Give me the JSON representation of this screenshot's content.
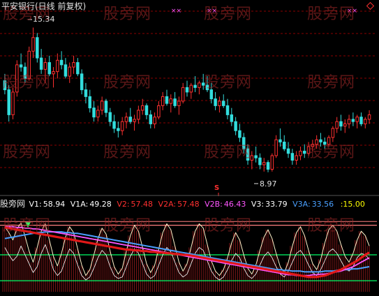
{
  "title": "平安银行(日线 前复权)",
  "watermark": "股旁网",
  "price_high_label": "15.34",
  "price_low_label": "8.97",
  "signal_label": "S",
  "indicator": {
    "name": "股旁网",
    "items": [
      {
        "label": "V1:",
        "value": "58.94",
        "color": "#ffffff"
      },
      {
        "label": "V1A:",
        "value": "49.28",
        "color": "#ffffff"
      },
      {
        "label": "V2:",
        "value": "57.48",
        "color": "#ff3030"
      },
      {
        "label": "V2A:",
        "value": "57.48",
        "color": "#ff3030"
      },
      {
        "label": "V2B:",
        "value": "46.43",
        "color": "#ff55ff"
      },
      {
        "label": "V3:",
        "value": "33.79",
        "color": "#ffffff"
      },
      {
        "label": "V3A:",
        "value": "33.56",
        "color": "#4aa0ff"
      },
      {
        "label": "",
        "value": ":15.00",
        "color": "#ffff00"
      }
    ]
  },
  "colors": {
    "up": "#ff3030",
    "down": "#33dddd",
    "grid": "#8b0000",
    "v1": "#fff0c8",
    "v1a": "#ffffff",
    "v2": "#e01818",
    "v2b": "#ff55ff",
    "v3a": "#4aa0ff",
    "level": "#00ff66",
    "volume": "#aa2020"
  },
  "chart_data": [
    {
      "type": "candlestick",
      "ylim": [
        8.5,
        16.0
      ],
      "candles": [
        [
          13.0,
          13.3,
          12.4,
          12.6
        ],
        [
          12.6,
          12.8,
          11.2,
          11.5
        ],
        [
          11.5,
          12.7,
          11.3,
          12.5
        ],
        [
          12.5,
          13.9,
          12.3,
          13.7
        ],
        [
          13.7,
          14.2,
          13.4,
          13.6
        ],
        [
          13.6,
          13.8,
          12.9,
          13.1
        ],
        [
          13.1,
          14.5,
          13.0,
          14.3
        ],
        [
          14.3,
          15.34,
          14.0,
          14.9
        ],
        [
          14.9,
          15.1,
          13.8,
          14.0
        ],
        [
          14.0,
          14.4,
          13.3,
          13.5
        ],
        [
          13.5,
          14.0,
          12.9,
          13.8
        ],
        [
          13.8,
          14.1,
          13.2,
          13.3
        ],
        [
          13.3,
          13.6,
          12.7,
          13.4
        ],
        [
          13.4,
          14.2,
          13.1,
          13.9
        ],
        [
          13.9,
          14.3,
          13.5,
          13.7
        ],
        [
          13.7,
          14.0,
          13.1,
          13.2
        ],
        [
          13.2,
          13.8,
          12.9,
          13.6
        ],
        [
          13.6,
          14.1,
          13.3,
          13.8
        ],
        [
          13.8,
          14.0,
          13.2,
          13.3
        ],
        [
          13.3,
          13.5,
          12.4,
          12.6
        ],
        [
          12.6,
          12.9,
          12.0,
          12.3
        ],
        [
          12.3,
          12.6,
          11.6,
          11.8
        ],
        [
          11.8,
          12.1,
          11.2,
          11.4
        ],
        [
          11.4,
          11.9,
          11.2,
          11.7
        ],
        [
          11.7,
          12.3,
          11.5,
          12.1
        ],
        [
          12.1,
          12.2,
          11.4,
          11.6
        ],
        [
          11.6,
          11.8,
          11.0,
          11.2
        ],
        [
          11.2,
          11.5,
          10.7,
          10.9
        ],
        [
          10.9,
          11.2,
          10.5,
          10.8
        ],
        [
          10.8,
          11.4,
          10.6,
          11.2
        ],
        [
          11.2,
          11.6,
          10.9,
          11.4
        ],
        [
          11.4,
          11.8,
          11.1,
          11.2
        ],
        [
          11.2,
          11.5,
          10.8,
          11.3
        ],
        [
          11.3,
          11.9,
          11.1,
          11.7
        ],
        [
          11.7,
          12.2,
          11.5,
          11.9
        ],
        [
          11.9,
          12.0,
          11.3,
          11.5
        ],
        [
          11.5,
          11.7,
          10.9,
          11.1
        ],
        [
          11.1,
          11.6,
          10.9,
          11.4
        ],
        [
          11.4,
          12.1,
          11.3,
          11.9
        ],
        [
          11.9,
          12.5,
          11.7,
          12.3
        ],
        [
          12.3,
          12.6,
          11.9,
          12.0
        ],
        [
          12.0,
          12.4,
          11.6,
          12.2
        ],
        [
          12.2,
          12.5,
          11.8,
          11.9
        ],
        [
          11.9,
          12.3,
          11.5,
          12.1
        ],
        [
          12.1,
          12.9,
          12.0,
          12.7
        ],
        [
          12.7,
          13.0,
          12.3,
          12.5
        ],
        [
          12.5,
          12.9,
          12.2,
          12.8
        ],
        [
          12.8,
          13.2,
          12.5,
          12.7
        ],
        [
          12.7,
          13.0,
          12.4,
          12.9
        ],
        [
          12.9,
          13.3,
          12.6,
          12.8
        ],
        [
          12.8,
          13.2,
          12.5,
          12.6
        ],
        [
          12.6,
          12.9,
          12.0,
          12.2
        ],
        [
          12.2,
          12.5,
          11.7,
          11.9
        ],
        [
          11.9,
          12.3,
          11.6,
          12.1
        ],
        [
          12.1,
          12.4,
          11.8,
          11.9
        ],
        [
          11.9,
          12.2,
          11.3,
          11.5
        ],
        [
          11.5,
          11.8,
          11.0,
          11.2
        ],
        [
          11.2,
          11.4,
          10.6,
          10.8
        ],
        [
          10.8,
          11.1,
          10.3,
          10.5
        ],
        [
          10.5,
          10.7,
          9.8,
          10.0
        ],
        [
          10.0,
          10.2,
          9.3,
          9.5
        ],
        [
          9.5,
          9.9,
          9.1,
          9.7
        ],
        [
          9.7,
          10.1,
          9.4,
          9.6
        ],
        [
          9.6,
          9.8,
          9.1,
          9.3
        ],
        [
          9.3,
          9.6,
          9.0,
          9.4
        ],
        [
          9.4,
          9.5,
          8.97,
          9.1
        ],
        [
          9.1,
          9.8,
          9.0,
          9.7
        ],
        [
          9.7,
          10.6,
          9.6,
          10.4
        ],
        [
          10.4,
          10.9,
          10.1,
          10.3
        ],
        [
          10.3,
          10.6,
          9.9,
          10.0
        ],
        [
          10.0,
          10.3,
          9.6,
          9.8
        ],
        [
          9.8,
          10.0,
          9.3,
          9.5
        ],
        [
          9.5,
          9.9,
          9.3,
          9.7
        ],
        [
          9.7,
          10.1,
          9.5,
          9.9
        ],
        [
          9.9,
          10.2,
          9.6,
          9.8
        ],
        [
          9.8,
          10.3,
          9.7,
          10.1
        ],
        [
          10.1,
          10.4,
          9.9,
          10.2
        ],
        [
          10.2,
          10.6,
          10.0,
          10.4
        ],
        [
          10.4,
          10.7,
          10.1,
          10.3
        ],
        [
          10.3,
          10.5,
          10.0,
          10.2
        ],
        [
          10.2,
          10.6,
          10.1,
          10.5
        ],
        [
          10.5,
          11.0,
          10.3,
          10.9
        ],
        [
          10.9,
          11.4,
          10.7,
          11.2
        ],
        [
          11.2,
          11.5,
          10.8,
          11.0
        ],
        [
          11.0,
          11.3,
          10.7,
          11.1
        ],
        [
          11.1,
          11.5,
          10.9,
          11.3
        ],
        [
          11.3,
          11.6,
          11.0,
          11.2
        ],
        [
          11.2,
          11.5,
          10.9,
          11.4
        ],
        [
          11.4,
          11.6,
          11.0,
          11.1
        ],
        [
          11.1,
          11.4,
          10.9,
          11.3
        ],
        [
          11.3,
          11.7,
          11.1,
          11.5
        ]
      ]
    },
    {
      "type": "line",
      "ylim": [
        0,
        100
      ],
      "levels": [
        15,
        50,
        90
      ],
      "series": [
        {
          "name": "V1",
          "values": [
            88,
            80,
            70,
            85,
            93,
            75,
            55,
            40,
            60,
            82,
            92,
            70,
            48,
            35,
            52,
            74,
            88,
            80,
            58,
            36,
            22,
            30,
            50,
            72,
            86,
            78,
            55,
            34,
            24,
            32,
            55,
            76,
            90,
            82,
            60,
            38,
            26,
            36,
            58,
            80,
            92,
            84,
            62,
            40,
            28,
            38,
            60,
            82,
            92,
            86,
            64,
            42,
            28,
            22,
            30,
            46,
            66,
            80,
            70,
            50,
            32,
            24,
            36,
            56,
            74,
            84,
            72,
            52,
            34,
            26,
            40,
            62,
            80,
            88,
            76,
            56,
            38,
            30,
            44,
            66,
            84,
            90,
            82,
            64,
            48,
            40,
            52,
            70,
            82,
            76,
            62
          ]
        },
        {
          "name": "V1A",
          "values": [
            60,
            50,
            42,
            48,
            62,
            50,
            38,
            26,
            34,
            52,
            64,
            48,
            30,
            22,
            28,
            44,
            58,
            52,
            36,
            22,
            16,
            20,
            32,
            46,
            56,
            50,
            34,
            22,
            18,
            20,
            34,
            48,
            58,
            52,
            38,
            24,
            18,
            22,
            36,
            50,
            60,
            54,
            40,
            26,
            20,
            24,
            38,
            52,
            60,
            56,
            42,
            28,
            20,
            16,
            20,
            30,
            42,
            52,
            46,
            32,
            22,
            18,
            24,
            36,
            48,
            54,
            46,
            34,
            24,
            20,
            28,
            40,
            52,
            56,
            48,
            36,
            26,
            22,
            30,
            42,
            54,
            58,
            52,
            42,
            32,
            28,
            34,
            46,
            52,
            50,
            44
          ]
        },
        {
          "name": "V2",
          "values": [
            87,
            86,
            85,
            84,
            83,
            82,
            81,
            80,
            79,
            78,
            77,
            76,
            75,
            74,
            73,
            72,
            71,
            70,
            69,
            68,
            67,
            66,
            65,
            64,
            63,
            62,
            61,
            60,
            59,
            58,
            57,
            57,
            56,
            56,
            55,
            55,
            54,
            54,
            53,
            53,
            52,
            52,
            51,
            51,
            50,
            50,
            49,
            48,
            47,
            46,
            45,
            44,
            43,
            42,
            41,
            40,
            39,
            38,
            37,
            36,
            35,
            34,
            33,
            32,
            31,
            30,
            29,
            28,
            27,
            26,
            25,
            24,
            23,
            22,
            21,
            20,
            20,
            20,
            21,
            22,
            24,
            26,
            28,
            30,
            33,
            36,
            39,
            42,
            46,
            50,
            53
          ]
        },
        {
          "name": "V2B",
          "values": [
            88,
            88,
            88,
            87,
            87,
            86,
            86,
            85,
            85,
            84,
            83,
            82,
            81,
            80,
            79,
            78,
            77,
            76,
            75,
            74,
            73,
            72,
            71,
            70,
            69,
            68,
            67,
            66,
            65,
            64,
            63,
            62,
            61,
            60,
            59,
            58,
            57,
            56,
            55,
            54,
            53,
            52,
            51,
            50,
            49,
            48,
            47,
            46,
            45,
            44,
            43,
            42,
            41,
            40,
            39,
            38,
            37,
            36,
            35,
            34,
            33,
            32,
            31,
            30,
            29,
            28,
            27,
            26,
            25,
            24,
            23,
            23,
            22,
            22,
            22,
            22,
            23,
            23,
            24,
            24,
            25,
            26,
            27,
            28,
            30,
            32,
            34,
            37,
            40,
            43,
            46
          ]
        },
        {
          "name": "V3A",
          "values": [
            72,
            73,
            74,
            75,
            76,
            77,
            78,
            79,
            80,
            80,
            81,
            81,
            81,
            81,
            81,
            80,
            80,
            79,
            79,
            78,
            77,
            76,
            75,
            74,
            73,
            72,
            71,
            70,
            69,
            68,
            67,
            66,
            65,
            64,
            63,
            62,
            61,
            60,
            59,
            58,
            57,
            56,
            55,
            54,
            53,
            52,
            51,
            50,
            49,
            48,
            47,
            46,
            45,
            44,
            43,
            42,
            41,
            40,
            39,
            38,
            37,
            36,
            35,
            34,
            33,
            32,
            31,
            30,
            30,
            29,
            29,
            28,
            28,
            28,
            27,
            27,
            27,
            27,
            27,
            28,
            28,
            28,
            29,
            29,
            30,
            30,
            31,
            31,
            32,
            33,
            34
          ]
        }
      ]
    }
  ]
}
